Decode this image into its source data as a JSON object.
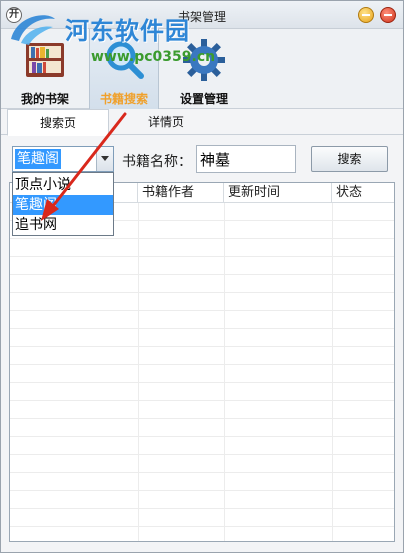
{
  "window": {
    "title": "书架管理",
    "app_icon_glyph": "开"
  },
  "watermark": {
    "site_name": "河东软件园",
    "url": "www.pc0359.cn"
  },
  "main_tabs": [
    {
      "label": "我的书架",
      "icon": "bookshelf-icon",
      "active": false
    },
    {
      "label": "书籍搜索",
      "icon": "magnifier-icon",
      "active": true
    },
    {
      "label": "设置管理",
      "icon": "gear-icon",
      "active": false
    }
  ],
  "sub_tabs": [
    {
      "label": "搜索页",
      "active": true
    },
    {
      "label": "详情页",
      "active": false
    }
  ],
  "search": {
    "source_selected": "笔趣阁",
    "source_options": [
      "顶点小说",
      "笔趣阁",
      "追书网"
    ],
    "book_name_label": "书籍名称：",
    "book_name_value": "神墓",
    "search_button": "搜索"
  },
  "table": {
    "columns": [
      "",
      "书籍作者",
      "更新时间",
      "状态"
    ]
  },
  "colors": {
    "selection": "#3399ff",
    "active_tab_label": "#f0a02a",
    "annotation_arrow": "#d9281c"
  }
}
